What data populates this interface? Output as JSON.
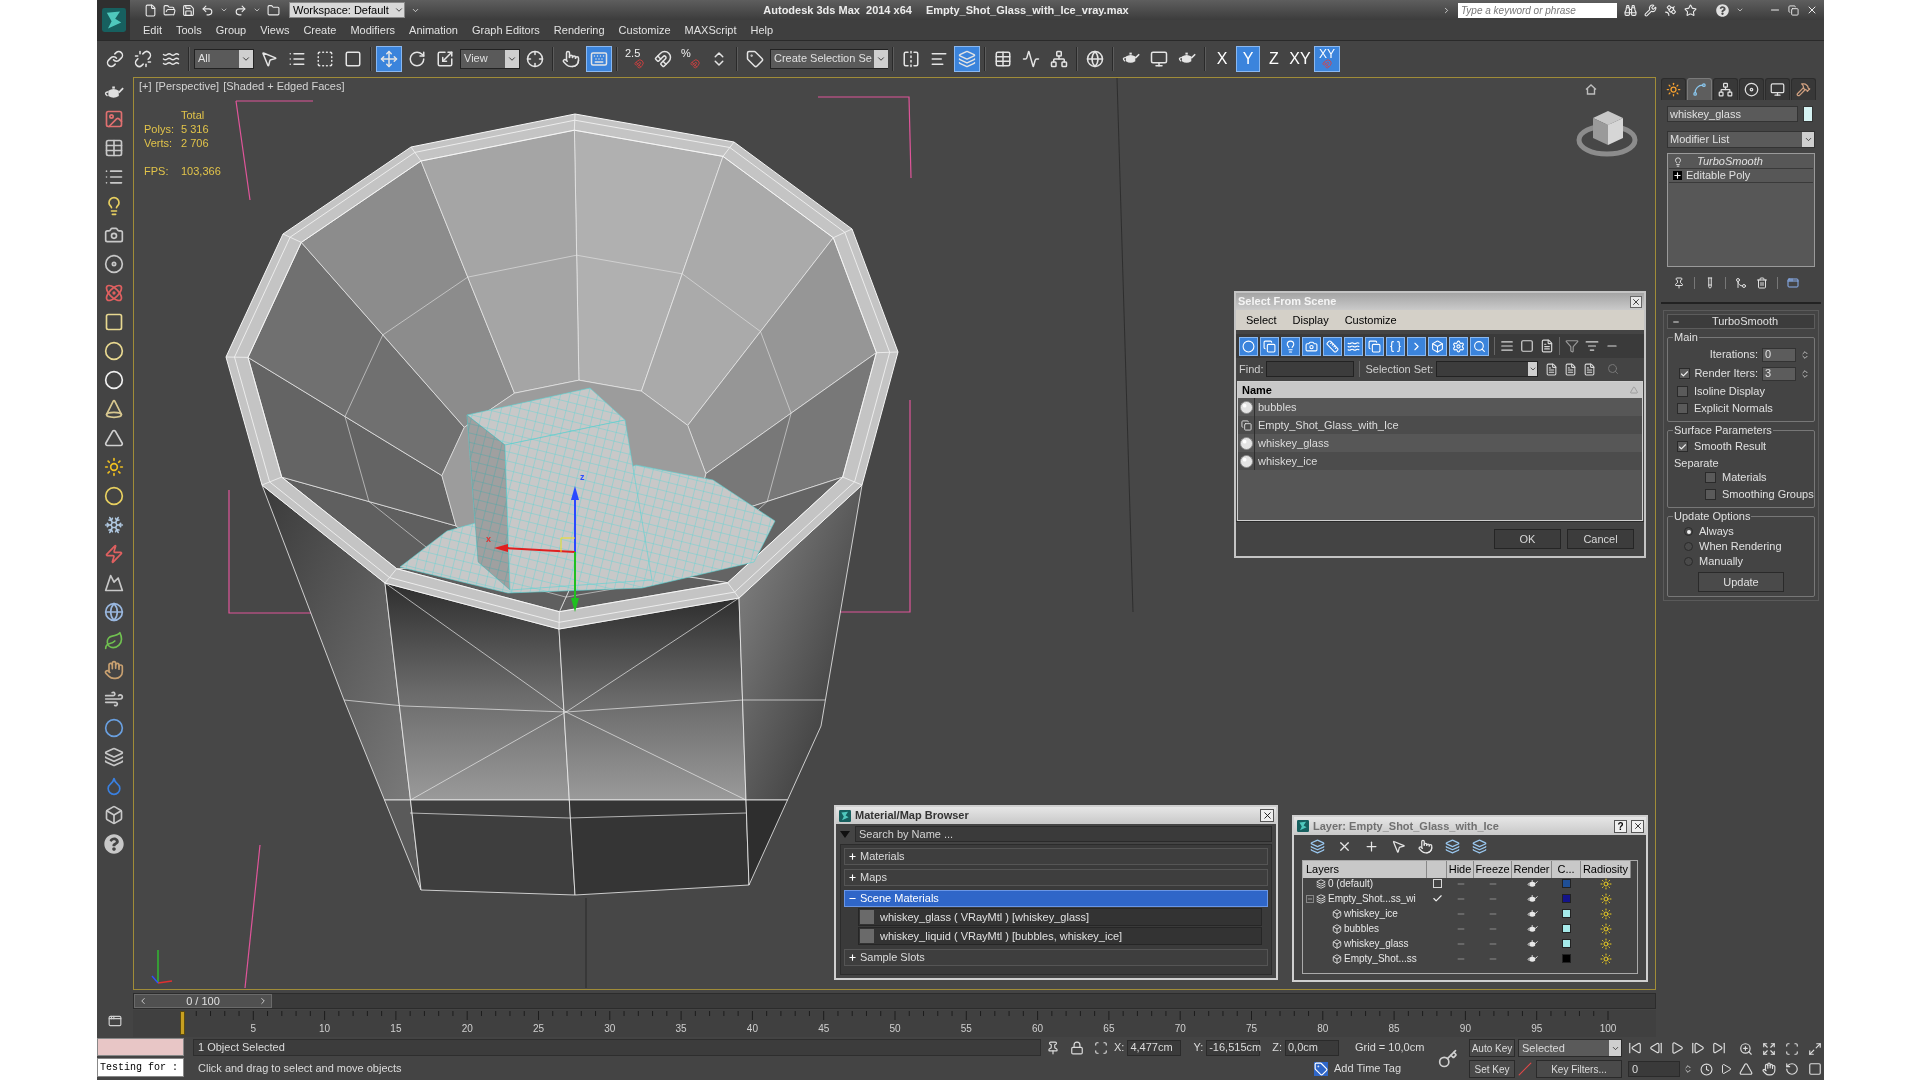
{
  "title_bar": {
    "workspace": "Workspace: Default",
    "app_name": "Autodesk 3ds Max  2014 x64",
    "file_name": "Empty_Shot_Glass_with_Ice_vray.max",
    "search": {
      "placeholder": "Type a keyword or phrase"
    }
  },
  "menu": [
    "Edit",
    "Tools",
    "Group",
    "Views",
    "Create",
    "Modifiers",
    "Animation",
    "Graph Editors",
    "Rendering",
    "Customize",
    "MAXScript",
    "Help"
  ],
  "main_toolbar": {
    "groups": [
      {
        "items": [
          {
            "kind": "icon",
            "selected": false
          },
          {
            "kind": "icon",
            "selected": false
          },
          {
            "kind": "icon",
            "selected": false
          }
        ]
      },
      {
        "items": [
          {
            "kind": "dropdown",
            "value": "All"
          },
          {
            "kind": "icon",
            "selected": false
          },
          {
            "kind": "icon",
            "selected": false
          },
          {
            "kind": "icon",
            "selected": false
          },
          {
            "kind": "icon",
            "selected": false
          }
        ]
      },
      {
        "items": [
          {
            "kind": "icon",
            "selected": true
          },
          {
            "kind": "icon",
            "selected": false
          },
          {
            "kind": "icon",
            "selected": false
          },
          {
            "kind": "dropdown",
            "value": "View"
          },
          {
            "kind": "icon",
            "selected": false
          }
        ]
      },
      {
        "items": [
          {
            "kind": "icon",
            "selected": false
          },
          {
            "kind": "icon",
            "selected": true
          }
        ]
      },
      {
        "items": [
          {
            "kind": "snap",
            "label": "2.5",
            "selected": false
          },
          {
            "kind": "icon",
            "selected": false
          },
          {
            "kind": "snap",
            "label": "%",
            "selected": false
          },
          {
            "kind": "icon",
            "selected": false
          }
        ]
      },
      {
        "items": [
          {
            "kind": "icon",
            "selected": false
          },
          {
            "kind": "dropdown",
            "value": "Create Selection Se"
          }
        ]
      },
      {
        "items": [
          {
            "kind": "icon",
            "selected": false
          },
          {
            "kind": "icon",
            "selected": false
          },
          {
            "kind": "icon",
            "selected": true
          }
        ]
      },
      {
        "items": [
          {
            "kind": "icon",
            "selected": false
          },
          {
            "kind": "icon",
            "selected": false
          },
          {
            "kind": "icon",
            "selected": false
          }
        ]
      },
      {
        "items": [
          {
            "kind": "icon",
            "selected": false
          }
        ]
      },
      {
        "items": [
          {
            "kind": "icon",
            "selected": false
          },
          {
            "kind": "icon",
            "selected": false
          },
          {
            "kind": "icon",
            "selected": false
          }
        ]
      },
      {
        "items": [
          {
            "kind": "axis",
            "label": "X",
            "selected": false
          },
          {
            "kind": "axis",
            "label": "Y",
            "selected": true
          },
          {
            "kind": "axis",
            "label": "Z",
            "selected": false
          },
          {
            "kind": "axis",
            "label": "XY",
            "selected": false
          },
          {
            "kind": "axis_snap",
            "label": "XY",
            "selected": true
          }
        ]
      }
    ]
  },
  "viewport": {
    "labels": [
      "[+]",
      "[Perspective]",
      "[Shaded + Edged Faces]"
    ],
    "stats": {
      "heading": "Total",
      "rows": [
        {
          "label": "Polys:",
          "value": "5 316"
        },
        {
          "label": "Verts:",
          "value": "2 706"
        },
        {
          "label": "FPS:",
          "value": "103,366"
        }
      ]
    },
    "gizmo": {
      "axis_labels": [
        "z",
        "x"
      ]
    }
  },
  "select_from_scene": {
    "title": "Select From Scene",
    "menu": [
      "Select",
      "Display",
      "Customize"
    ],
    "filters": [
      {
        "selected": true
      },
      {
        "selected": true
      },
      {
        "selected": true
      },
      {
        "selected": true
      },
      {
        "selected": true
      },
      {
        "selected": true
      },
      {
        "selected": true
      },
      {
        "selected": true
      },
      {
        "selected": true
      },
      {
        "selected": true
      },
      {
        "selected": true
      },
      {
        "selected": true
      }
    ],
    "find": {
      "label": "Find:"
    },
    "selection_set": {
      "label": "Selection Set:"
    },
    "column": "Name",
    "rows": [
      {
        "name": "bubbles",
        "kind": "geometry",
        "selected": false
      },
      {
        "name": "Empty_Shot_Glass_with_Ice",
        "kind": "group",
        "selected": false
      },
      {
        "name": "whiskey_glass",
        "kind": "geometry",
        "selected": false
      },
      {
        "name": "whiskey_ice",
        "kind": "geometry",
        "selected": false
      }
    ],
    "buttons": [
      "OK",
      "Cancel"
    ]
  },
  "material_browser": {
    "title": "Material/Map Browser",
    "search": {
      "placeholder": "Search by Name ..."
    },
    "sections": [
      {
        "label": "Materials",
        "expanded": false,
        "selected": false
      },
      {
        "label": "Maps",
        "expanded": false,
        "selected": false
      },
      {
        "label": "Scene Materials",
        "expanded": true,
        "selected": true,
        "items": [
          "whiskey_glass ( VRayMtl ) [whiskey_glass]",
          "whiskey_liquid ( VRayMtl ) [bubbles, whiskey_ice]"
        ]
      },
      {
        "label": "Sample Slots",
        "expanded": false,
        "selected": false
      }
    ]
  },
  "layer_manager": {
    "title": "Layer: Empty_Shot_Glass_with_Ice",
    "help": "?",
    "columns": [
      "Layers",
      "Hide",
      "Freeze",
      "Render",
      "C...",
      "Radiosity"
    ],
    "rows": [
      {
        "name": "0 (default)",
        "current": false,
        "hidden": false,
        "frozen": false,
        "color": "#1f4f96"
      },
      {
        "name": "Empty_Shot...ss_wi",
        "current": true,
        "expanded": true,
        "hidden": false,
        "frozen": false,
        "color": "#14148a",
        "children": [
          {
            "name": "whiskey_ice",
            "hidden": false,
            "frozen": false,
            "color": "#a6eaea"
          },
          {
            "name": "bubbles",
            "hidden": false,
            "frozen": false,
            "color": "#a6eaea"
          },
          {
            "name": "whiskey_glass",
            "hidden": false,
            "frozen": false,
            "color": "#a6eaea"
          },
          {
            "name": "Empty_Shot...ss",
            "hidden": false,
            "frozen": false,
            "color": "#000000"
          }
        ]
      }
    ]
  },
  "command_panel": {
    "tabs": [
      {
        "selected": false
      },
      {
        "selected": true
      },
      {
        "selected": false
      },
      {
        "selected": false
      },
      {
        "selected": false
      },
      {
        "selected": false
      }
    ],
    "object": {
      "name": "whiskey_glass",
      "color": "#d6f3f3"
    },
    "modifier_list": "Modifier List",
    "stack": [
      {
        "name": "TurboSmooth",
        "kind": "modifier"
      },
      {
        "name": "Editable Poly",
        "kind": "base"
      }
    ],
    "rollout": {
      "title": "TurboSmooth",
      "expanded": true,
      "groups": [
        {
          "title": "Main",
          "controls": [
            {
              "kind": "spinner",
              "label": "Iterations:",
              "value": "0"
            },
            {
              "kind": "spinner",
              "label": "Render Iters:",
              "value": "3",
              "checked": true
            },
            {
              "kind": "checkbox",
              "label": "Isoline Display",
              "checked": false
            },
            {
              "kind": "checkbox",
              "label": "Explicit Normals",
              "checked": false
            }
          ]
        },
        {
          "title": "Surface Parameters",
          "controls": [
            {
              "kind": "checkbox",
              "label": "Smooth Result",
              "checked": true
            },
            {
              "kind": "label",
              "label": "Separate",
              "children": [
                {
                  "kind": "checkbox",
                  "label": "Materials",
                  "checked": false
                },
                {
                  "kind": "checkbox",
                  "label": "Smoothing Groups",
                  "checked": false
                }
              ]
            }
          ]
        },
        {
          "title": "Update Options",
          "controls": [
            {
              "kind": "radio",
              "label": "Always",
              "selected": true
            },
            {
              "kind": "radio",
              "label": "When Rendering",
              "selected": false
            },
            {
              "kind": "radio",
              "label": "Manually",
              "selected": false
            },
            {
              "kind": "button",
              "label": "Update"
            }
          ]
        }
      ]
    }
  },
  "time_slider": {
    "label": "0 / 100",
    "level": 0
  },
  "track_bar": {
    "labels": [
      "5",
      "10",
      "15",
      "20",
      "25",
      "30",
      "35",
      "40",
      "45",
      "50",
      "55",
      "60",
      "65",
      "70",
      "75",
      "80",
      "85",
      "90",
      "95",
      "100"
    ]
  },
  "listener": {
    "output": "Testing for :"
  },
  "status": {
    "selection": "1 Object Selected",
    "prompt": "Click and drag to select and move objects",
    "coords": [
      {
        "label": "X:",
        "value": "4,477cm"
      },
      {
        "label": "Y:",
        "value": "-16,515cm"
      },
      {
        "label": "Z:",
        "value": "0,0cm"
      }
    ],
    "grid": "Grid = 10,0cm",
    "add_time_tag": "Add Time Tag",
    "auto_key": "Auto Key",
    "set_key": "Set Key",
    "key_mode": "Selected",
    "key_filters": "Key Filters...",
    "frame": "0"
  }
}
